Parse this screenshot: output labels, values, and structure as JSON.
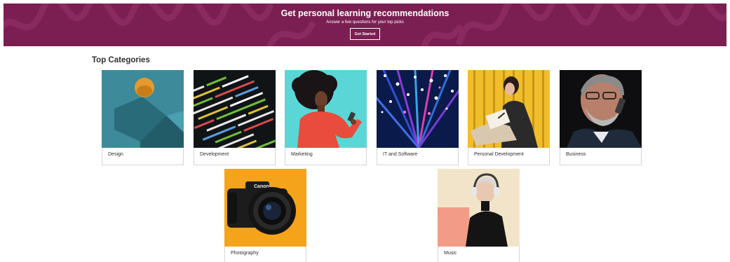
{
  "banner": {
    "title": "Get personal learning recommendations",
    "subtitle": "Answer a few questions for your top picks",
    "button_label": "Get Started"
  },
  "section": {
    "title": "Top Categories"
  },
  "categories": [
    {
      "label": "Design"
    },
    {
      "label": "Development"
    },
    {
      "label": "Marketing"
    },
    {
      "label": "IT and Software"
    },
    {
      "label": "Personal Development"
    },
    {
      "label": "Business"
    },
    {
      "label": "Photography"
    },
    {
      "label": "Music"
    }
  ],
  "colors": {
    "banner_bg": "#7b1f52",
    "card_border": "#d1d7dc",
    "text": "#2d2f31"
  }
}
